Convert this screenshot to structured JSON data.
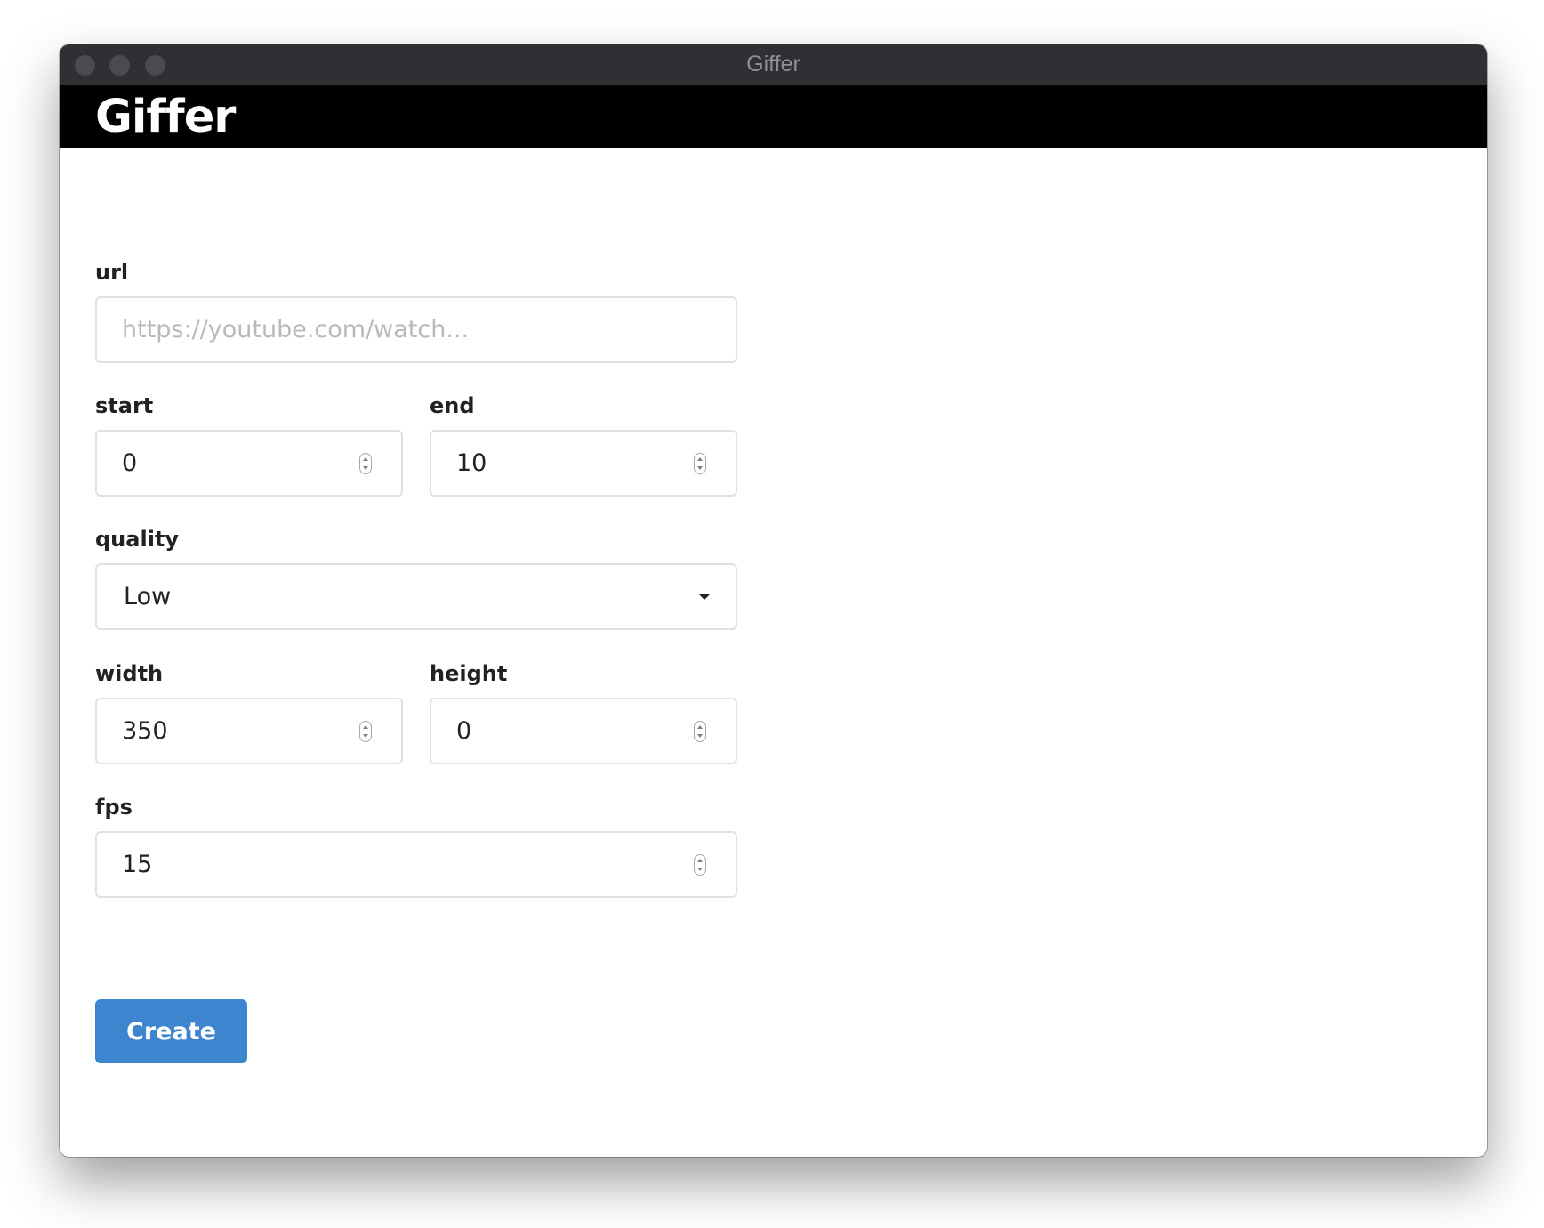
{
  "window": {
    "title": "Giffer"
  },
  "header": {
    "title": "Giffer"
  },
  "form": {
    "url": {
      "label": "url",
      "value": "",
      "placeholder": "https://youtube.com/watch..."
    },
    "start": {
      "label": "start",
      "value": "0"
    },
    "end": {
      "label": "end",
      "value": "10"
    },
    "quality": {
      "label": "quality",
      "selected": "Low"
    },
    "width": {
      "label": "width",
      "value": "350"
    },
    "height": {
      "label": "height",
      "value": "0"
    },
    "fps": {
      "label": "fps",
      "value": "15"
    },
    "submit_label": "Create"
  },
  "colors": {
    "titlebar": "#2f3033",
    "header": "#000000",
    "accent": "#3d85cf"
  },
  "icons": {
    "spinner": "number-spinner-icon",
    "dropdown": "caret-down-icon"
  }
}
